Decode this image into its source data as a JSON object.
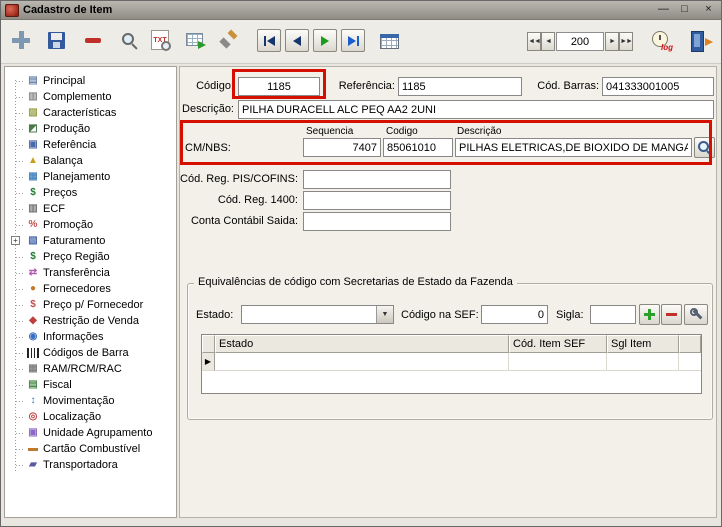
{
  "titlebar": {
    "title": "Cadastro de Item",
    "minimize_glyph": "—",
    "maximize_glyph": "□",
    "close_glyph": "×"
  },
  "toolbar": {
    "txt_label": "TXT",
    "log_label": "log",
    "record_number": "200"
  },
  "sidebar": {
    "items": [
      {
        "label": "Principal"
      },
      {
        "label": "Complemento"
      },
      {
        "label": "Características"
      },
      {
        "label": "Produção"
      },
      {
        "label": "Referência"
      },
      {
        "label": "Balança"
      },
      {
        "label": "Planejamento"
      },
      {
        "label": "Preços"
      },
      {
        "label": "ECF"
      },
      {
        "label": "Promoção"
      },
      {
        "label": "Faturamento"
      },
      {
        "label": "Preço Região"
      },
      {
        "label": "Transferência"
      },
      {
        "label": "Fornecedores"
      },
      {
        "label": "Preço p/ Fornecedor"
      },
      {
        "label": "Restrição de Venda"
      },
      {
        "label": "Informações"
      },
      {
        "label": "Códigos de Barra"
      },
      {
        "label": "RAM/RCM/RAC"
      },
      {
        "label": "Fiscal"
      },
      {
        "label": "Movimentação"
      },
      {
        "label": "Localização"
      },
      {
        "label": "Unidade Agrupamento"
      },
      {
        "label": "Cartão Combustível"
      },
      {
        "label": "Transportadora"
      }
    ]
  },
  "form": {
    "codigo": {
      "label": "Código:",
      "value": "1185"
    },
    "referencia": {
      "label": "Referência:",
      "value": "1185"
    },
    "cod_barras": {
      "label": "Cód. Barras:",
      "value": "041333001005"
    },
    "descricao": {
      "label": "Descrição:",
      "value": "PILHA DURACELL ALC PEQ AA2 2UNI"
    },
    "ncm": {
      "label": "CM/NBS:",
      "col_sequencia": "Sequencia",
      "col_codigo": "Codigo",
      "col_descricao": "Descrição",
      "sequencia": "7407",
      "codigo": "85061010",
      "descricao": "PILHAS ELETRICAS,DE BIOXIDO DE MANGANE"
    },
    "pis_cofins_label": "Cód. Reg. PIS/COFINS:",
    "reg_1400_label": "Cód. Reg. 1400:",
    "conta_contabil_label": "Conta Contábil Saida:"
  },
  "equivalencias": {
    "title": "Equivalências de código com Secretarias de Estado da Fazenda",
    "estado_label": "Estado:",
    "codigo_sef_label": "Código na SEF:",
    "codigo_sef_value": "0",
    "sigla_label": "Sigla:",
    "grid": {
      "headers": [
        "Estado",
        "Cód. Item SEF",
        "Sgl Item"
      ]
    }
  }
}
